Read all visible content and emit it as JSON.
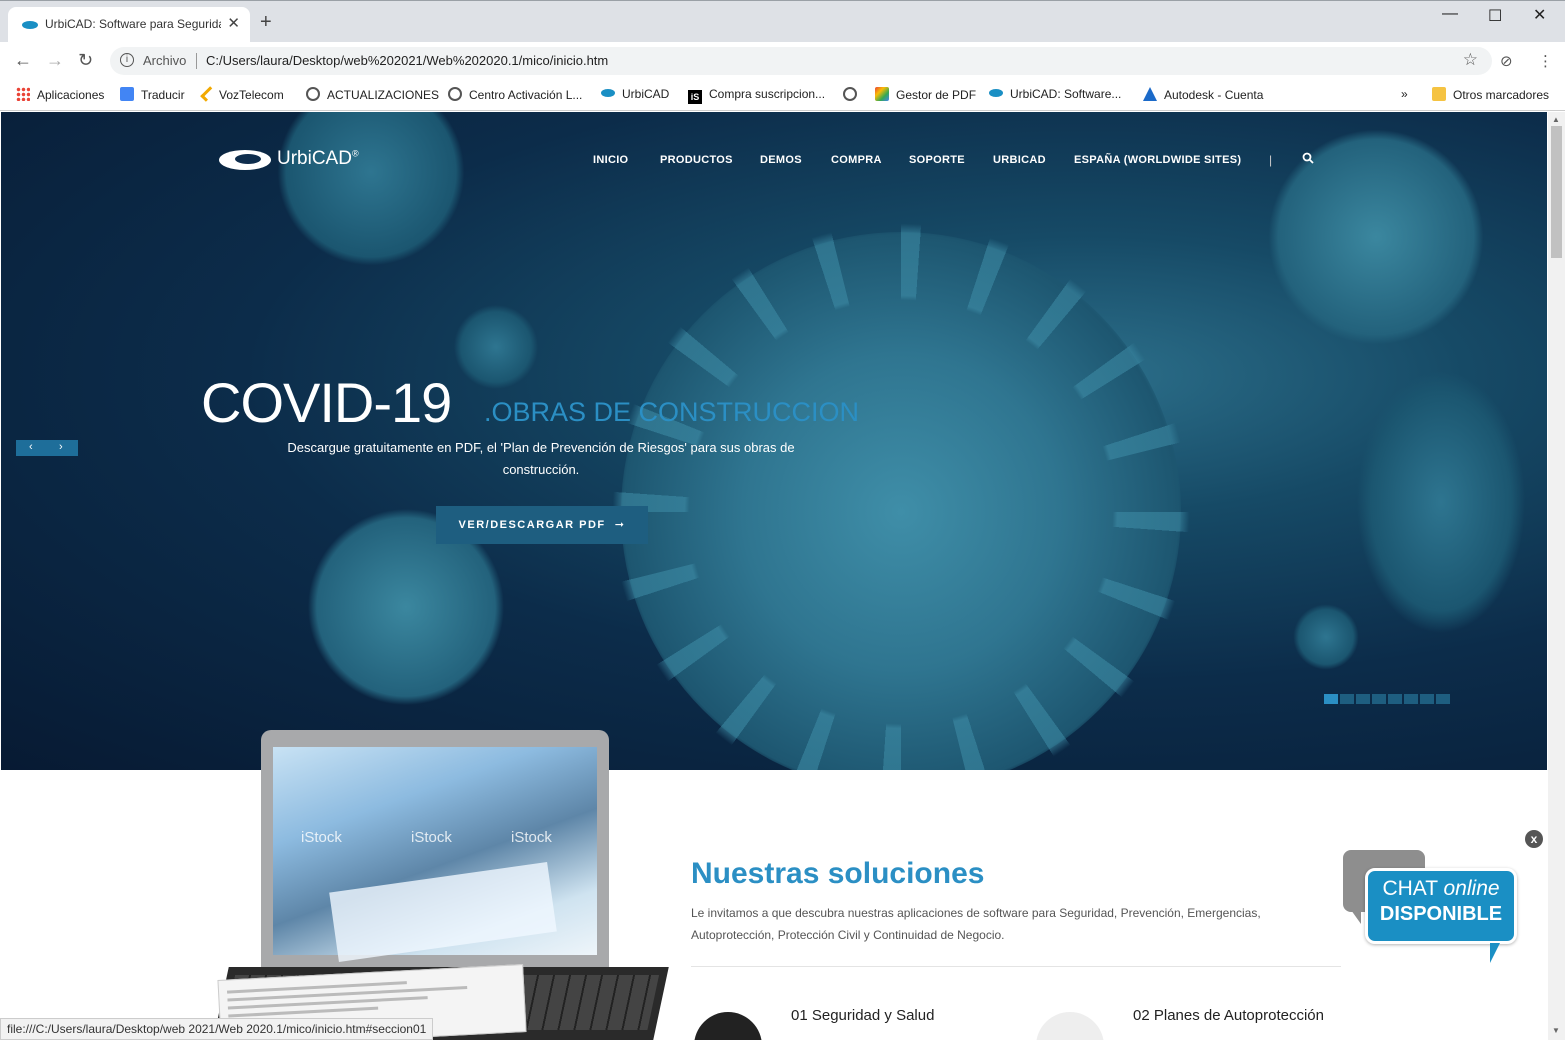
{
  "browser": {
    "tab_title": "UrbiCAD: Software para Seguridad",
    "url_scheme": "Archivo",
    "url": "C:/Users/laura/Desktop/web%202021/Web%202020.1/mico/inicio.htm",
    "status": "file:///C:/Users/laura/Desktop/web 2021/Web 2020.1/mico/inicio.htm#seccion01"
  },
  "bookmarks": [
    {
      "label": "Aplicaciones",
      "icon": "apps-grid-icon",
      "color": "#e94235"
    },
    {
      "label": "Traducir",
      "icon": "translate-icon",
      "color": "#4285f4"
    },
    {
      "label": "VozTelecom",
      "icon": "voztelecom-icon",
      "color": "#f2a900"
    },
    {
      "label": "ACTUALIZACIONES",
      "icon": "globe-icon",
      "color": "#555555"
    },
    {
      "label": "Centro Activación L...",
      "icon": "globe-icon",
      "color": "#555555"
    },
    {
      "label": "UrbiCAD",
      "icon": "urbicad-icon",
      "color": "#1a8fc4"
    },
    {
      "label": "Compra suscripcion...",
      "icon": "istock-icon",
      "color": "#000000"
    },
    {
      "label": "",
      "icon": "globe-icon",
      "color": "#555555"
    },
    {
      "label": "Gestor de PDF",
      "icon": "pdf-icon",
      "color": "#e94235"
    },
    {
      "label": "UrbiCAD: Software...",
      "icon": "urbicad-icon",
      "color": "#1a8fc4"
    },
    {
      "label": "Autodesk - Cuenta",
      "icon": "autodesk-icon",
      "color": "#1b6ac9"
    },
    {
      "label": "»",
      "icon": "",
      "color": ""
    },
    {
      "label": "Otros marcadores",
      "icon": "folder-icon",
      "color": "#f5c342"
    }
  ],
  "site": {
    "logo": "UrbiCAD",
    "logo_reg": "®",
    "nav": [
      "INICIO",
      "PRODUCTOS",
      "DEMOS",
      "COMPRA",
      "SOPORTE",
      "URBICAD",
      "ESPAÑA (WORLDWIDE SITES)"
    ],
    "nav_separator": "|"
  },
  "hero": {
    "title": "COVID-19",
    "subtitle": ".OBRAS DE CONSTRUCCION",
    "description": "Descargue gratuitamente en PDF, el 'Plan de Prevención de Riesgos' para sus obras de construcción.",
    "button": "VER/DESCARGAR PDF",
    "button_arrow": "➞",
    "prev": "‹",
    "next": "›",
    "slides": 8,
    "active_slide": 0
  },
  "solutions": {
    "title": "Nuestras soluciones",
    "text": "Le invitamos a que descubra nuestras aplicaciones de software para Seguridad, Prevención, Emergencias, Autoprotección, Protección Civil y Continuidad de Negocio.",
    "item1": "01 Seguridad y Salud",
    "item2": "02 Planes de Autoprotección"
  },
  "laptop_watermarks": [
    "iStock",
    "iStock",
    "iStock"
  ],
  "chat": {
    "close": "x",
    "line1a": "CHAT ",
    "line1b": "online",
    "line2": "DISPONIBLE"
  },
  "colors": {
    "accent": "#1a8fc4",
    "hero_dark": "#0c2c4a",
    "button": "#1e5e80"
  }
}
